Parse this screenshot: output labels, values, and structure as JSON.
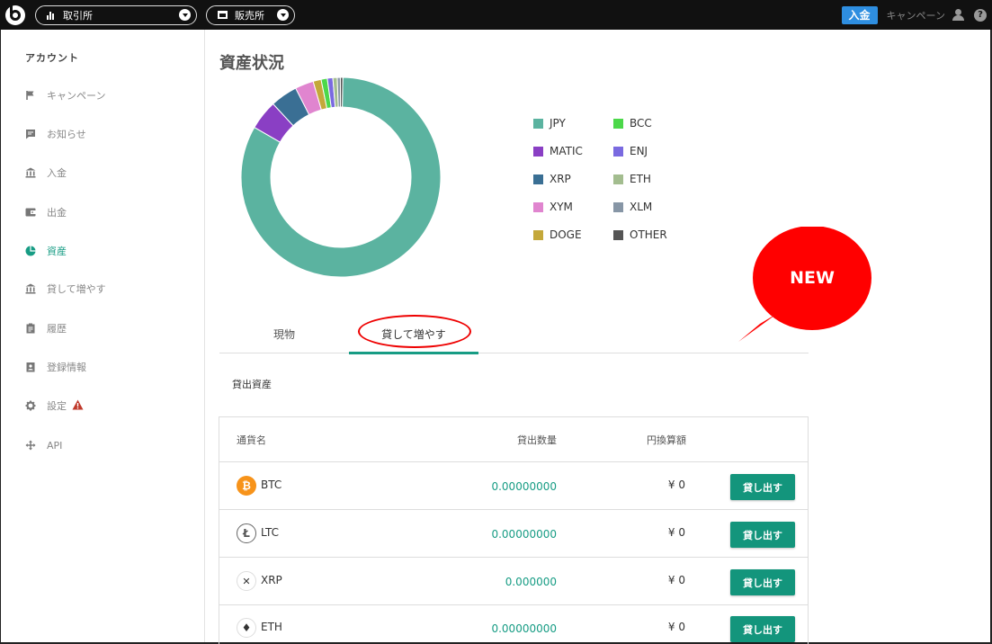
{
  "header": {
    "exchange_label": "取引所",
    "shop_label": "販売所",
    "deposit_label": "入金",
    "campaign_label": "キャンペーン",
    "help_glyph": "?"
  },
  "sidebar": {
    "heading": "アカウント",
    "items": [
      {
        "label": "キャンペーン",
        "icon": "flag-icon"
      },
      {
        "label": "お知らせ",
        "icon": "message-icon"
      },
      {
        "label": "入金",
        "icon": "bank-icon"
      },
      {
        "label": "出金",
        "icon": "wallet-icon"
      },
      {
        "label": "資産",
        "icon": "pie-chart-icon",
        "active": true
      },
      {
        "label": "貸して増やす",
        "icon": "bank-icon"
      },
      {
        "label": "履歴",
        "icon": "clipboard-icon"
      },
      {
        "label": "登録情報",
        "icon": "id-badge-icon"
      },
      {
        "label": "設定",
        "icon": "gear-icon",
        "warning": true
      },
      {
        "label": "API",
        "icon": "move-icon"
      }
    ]
  },
  "main": {
    "title": "資産状況",
    "new_badge": "NEW",
    "tabs": [
      {
        "label": "現物"
      },
      {
        "label": "貸して増やす",
        "active": true
      }
    ],
    "section_label": "貸出資産",
    "table": {
      "headers": {
        "name": "通貨名",
        "amount": "貸出数量",
        "yen": "円換算額"
      },
      "button_label": "貸し出す",
      "rows": [
        {
          "symbol": "BTC",
          "icon": "bitcoin-icon",
          "glyph": "₿",
          "amount": "0.00000000",
          "yen": "¥ 0"
        },
        {
          "symbol": "LTC",
          "icon": "litecoin-icon",
          "glyph": "Ł",
          "amount": "0.00000000",
          "yen": "¥ 0"
        },
        {
          "symbol": "XRP",
          "icon": "xrp-icon",
          "glyph": "✕",
          "amount": "0.000000",
          "yen": "¥ 0"
        },
        {
          "symbol": "ETH",
          "icon": "ethereum-icon",
          "glyph": "♦",
          "amount": "0.00000000",
          "yen": "¥ 0"
        }
      ]
    }
  },
  "chart_data": {
    "type": "pie",
    "variant": "donut",
    "legend_position": "right",
    "labels": [
      "JPY",
      "MATIC",
      "XRP",
      "XYM",
      "DOGE",
      "BCC",
      "ENJ",
      "ETH",
      "XLM",
      "OTHER"
    ],
    "values": [
      83.0,
      4.8,
      4.4,
      3.0,
      1.3,
      1.0,
      0.9,
      0.7,
      0.5,
      0.4
    ],
    "colors": [
      "#5bb3a0",
      "#8a3fc4",
      "#3a6f94",
      "#e085cf",
      "#c4a83a",
      "#4cd84a",
      "#7a6ae0",
      "#a3bd8f",
      "#8796a6",
      "#555555"
    ]
  }
}
